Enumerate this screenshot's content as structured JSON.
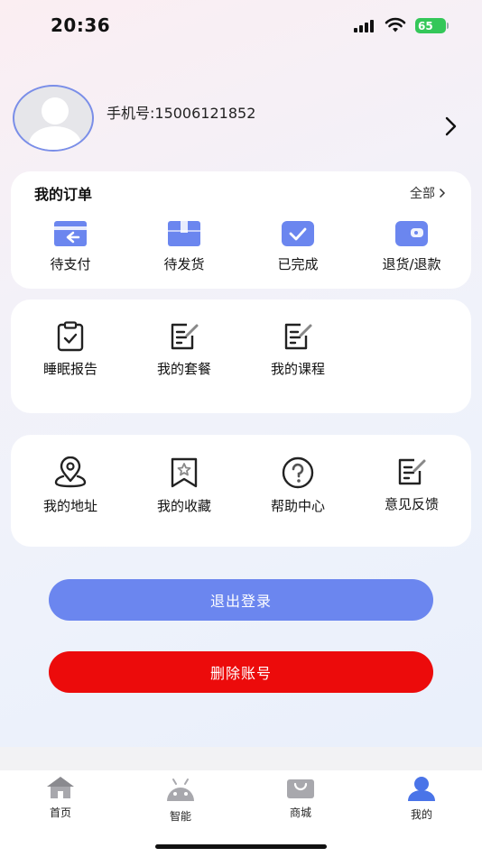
{
  "status_bar": {
    "time": "20:36",
    "battery": "65"
  },
  "profile": {
    "phone_label": "手机号:15006121852"
  },
  "orders": {
    "title": "我的订单",
    "more_label": "全部",
    "items": [
      {
        "label": "待支付",
        "icon": "wallet-return-icon"
      },
      {
        "label": "待发货",
        "icon": "package-icon"
      },
      {
        "label": "已完成",
        "icon": "check-box-icon"
      },
      {
        "label": "退货/退款",
        "icon": "refund-wallet-icon"
      }
    ]
  },
  "services": {
    "items": [
      {
        "label": "睡眠报告",
        "icon": "clipboard-check-icon"
      },
      {
        "label": "我的套餐",
        "icon": "edit-note-icon"
      },
      {
        "label": "我的课程",
        "icon": "edit-note-icon"
      }
    ]
  },
  "tools": {
    "items": [
      {
        "label": "我的地址",
        "icon": "location-pin-icon"
      },
      {
        "label": "我的收藏",
        "icon": "bookmark-star-icon"
      },
      {
        "label": "帮助中心",
        "icon": "question-circle-icon"
      },
      {
        "label": "意见反馈",
        "icon": "edit-note-icon"
      }
    ]
  },
  "buttons": {
    "logout": "退出登录",
    "delete_account": "删除账号"
  },
  "colors": {
    "accent": "#6b86ef",
    "danger": "#ec0b0b",
    "order_icon": "#6b86ef"
  },
  "tabbar": {
    "items": [
      {
        "label": "首页",
        "icon": "home-icon"
      },
      {
        "label": "智能",
        "icon": "android-icon"
      },
      {
        "label": "商城",
        "icon": "shopping-bag-icon"
      },
      {
        "label": "我的",
        "icon": "user-icon"
      }
    ]
  }
}
